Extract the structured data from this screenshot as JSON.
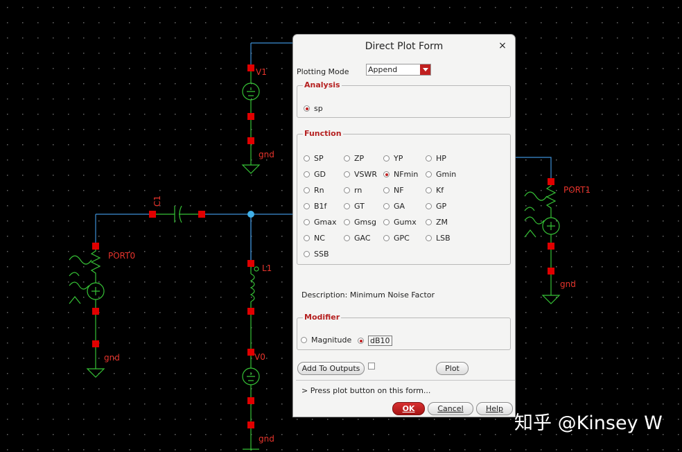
{
  "schematic": {
    "labels": {
      "v1": "V1",
      "gnd_top": "gnd",
      "c1": "C1",
      "port0": "PORT0",
      "gnd_left": "gnd",
      "l1": "L1",
      "v0": "V0",
      "gnd_bottom": "gnd",
      "port1": "PORT1",
      "gnd_right": "gnd"
    },
    "colors": {
      "wire": "#3e90d6",
      "component": "#36c236",
      "pin": "#e00000",
      "label": "#e8342c",
      "grid": "#5a5a5a"
    }
  },
  "dialog": {
    "title": "Direct Plot Form",
    "close_glyph": "×",
    "plotting_mode_label": "Plotting Mode",
    "plotting_mode_value": "Append",
    "analysis": {
      "title": "Analysis",
      "option": "sp",
      "selected": true
    },
    "function": {
      "title": "Function",
      "options": [
        "SP",
        "ZP",
        "YP",
        "HP",
        "GD",
        "VSWR",
        "NFmin",
        "Gmin",
        "Rn",
        "rn",
        "NF",
        "Kf",
        "B1f",
        "GT",
        "GA",
        "GP",
        "Gmax",
        "Gmsg",
        "Gumx",
        "ZM",
        "NC",
        "GAC",
        "GPC",
        "LSB",
        "SSB"
      ],
      "selected": "NFmin"
    },
    "description": "Description: Minimum Noise Factor",
    "modifier": {
      "title": "Modifier",
      "options": [
        "Magnitude",
        "dB10"
      ],
      "selected": "dB10"
    },
    "add_to_outputs_label": "Add To Outputs",
    "plot_label": "Plot",
    "status": "> Press plot button on this form...",
    "ok_label": "OK",
    "cancel_label": "Cancel",
    "help_label": "Help",
    "accent_color": "#c02020"
  },
  "watermark": "知乎 @Kinsey W"
}
